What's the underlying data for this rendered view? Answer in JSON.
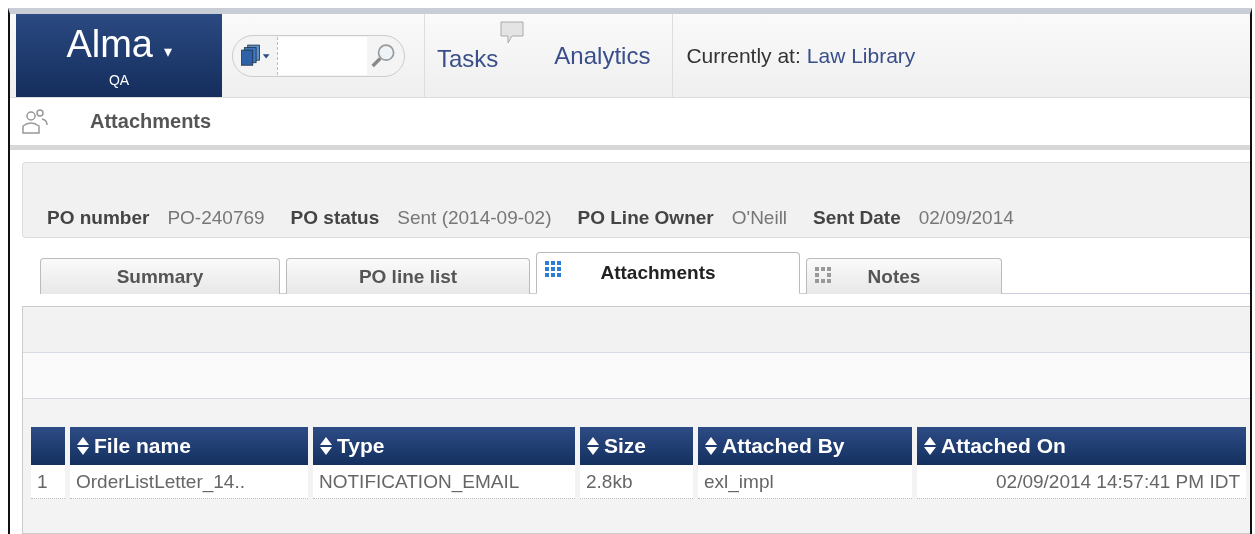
{
  "app": {
    "logo": "Alma",
    "logo_caret": "▾",
    "environment": "QA"
  },
  "nav": [
    {
      "label": "Tasks",
      "has_bubble": true
    },
    {
      "label": "Analytics",
      "has_bubble": false
    }
  ],
  "location": {
    "label": "Currently at:",
    "value": "Law Library"
  },
  "page_title": "Attachments",
  "po_fields": [
    {
      "label": "PO number",
      "value": "PO-240769"
    },
    {
      "label": "PO status",
      "value": "Sent (2014-09-02)"
    },
    {
      "label": "PO Line Owner",
      "value": "O'Neill"
    },
    {
      "label": "Sent Date",
      "value": "02/09/2014"
    }
  ],
  "tabs": [
    {
      "label": "Summary",
      "selected": false,
      "kind": "plain"
    },
    {
      "label": "PO line list",
      "selected": false,
      "kind": "plain"
    },
    {
      "label": "Attachments",
      "selected": true,
      "kind": "grid"
    },
    {
      "label": "Notes",
      "selected": false,
      "kind": "grid"
    }
  ],
  "table": {
    "columns": [
      "File name",
      "Type",
      "Size",
      "Attached By",
      "Attached On"
    ],
    "rows": [
      {
        "index": "1",
        "cells": [
          "OrderListLetter_14..",
          "NOTIFICATION_EMAIL",
          "2.8kb",
          "exl_impl",
          "02/09/2014 14:57:41 PM IDT"
        ]
      }
    ]
  }
}
